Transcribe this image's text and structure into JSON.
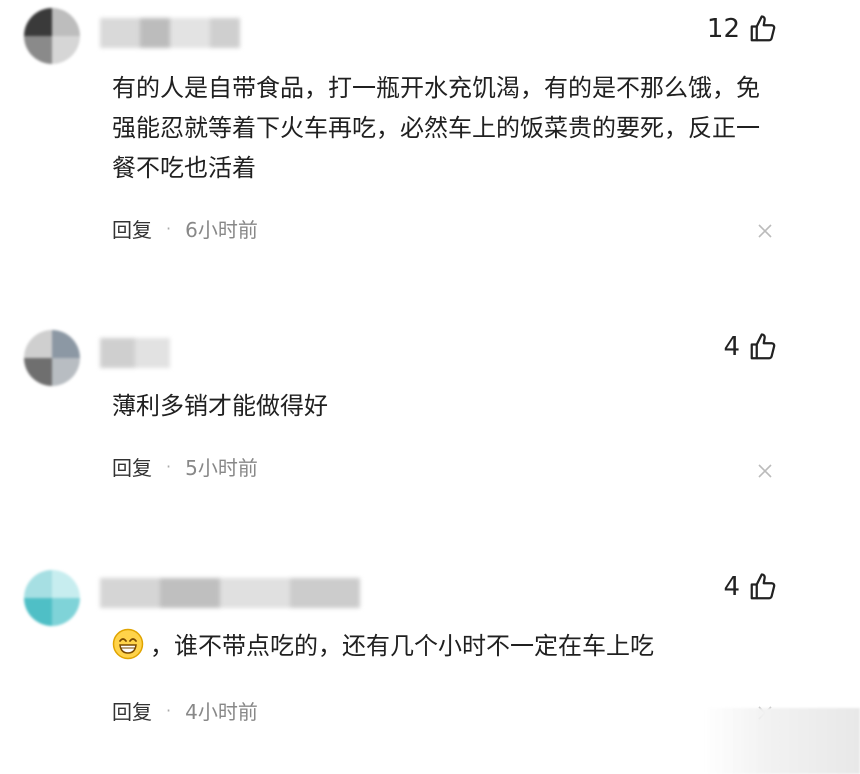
{
  "comments": [
    {
      "likes": "12",
      "text": "有的人是自带食品，打一瓶开水充饥渴，有的是不那么饿，免强能忍就等着下火车再吃，必然车上的饭菜贵的要死，反正一餐不吃也活着",
      "reply_label": "回复",
      "time": "6小时前"
    },
    {
      "likes": "4",
      "text": "薄利多销才能做得好",
      "reply_label": "回复",
      "time": "5小时前"
    },
    {
      "likes": "4",
      "text": "，谁不带点吃的，还有几个小时不一定在车上吃",
      "reply_label": "回复",
      "time": "4小时前",
      "emoji": "grin-emoji"
    }
  ],
  "icons": {
    "like": "thumbs-up-icon",
    "close": "close-icon"
  },
  "colors": {
    "text": "#202020",
    "meta": "#888888",
    "background": "#ffffff"
  }
}
